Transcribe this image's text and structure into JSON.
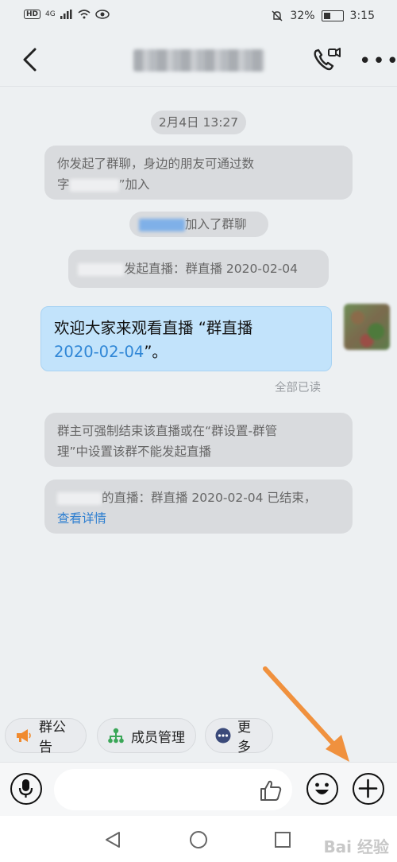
{
  "status_bar": {
    "hd": "HD",
    "signal": "4G",
    "battery": "32%",
    "time": "3:15"
  },
  "nav": {
    "title": "",
    "more_label": "•••"
  },
  "messages": {
    "timestamp": "2月4日 13:27",
    "sys1": {
      "part1": "你发起了群聊，身边的朋友可通过数",
      "part2": "字",
      "part3": "”加入"
    },
    "sys2": {
      "suffix": "加入了群聊"
    },
    "sys3": {
      "suffix": "发起直播：群直播 2020-02-04"
    },
    "mine": {
      "part1": "欢迎大家来观看直播 “群直播",
      "link": "2020-02-04",
      "part2": "”。"
    },
    "read_status": "全部已读",
    "sys4": {
      "line1": "群主可强制结束该直播或在“群设置-群管",
      "line2": "理”中设置该群不能发起直播"
    },
    "sys5": {
      "suffix": "的直播：群直播 2020-02-04 已结束，",
      "link": "查看详情"
    }
  },
  "quick_actions": [
    {
      "label": "群公告",
      "icon": "megaphone-icon"
    },
    {
      "label": "成员管理",
      "icon": "org-tree-icon"
    },
    {
      "label": "更多",
      "icon": "more-dots-icon"
    }
  ],
  "input_bar": {
    "placeholder": ""
  },
  "watermark": "Bai 经验",
  "colors": {
    "accent_blue": "#2f86d6",
    "own_bubble": "#c2e3fb",
    "system_bubble": "#d9dbde",
    "arrow": "#f0913e",
    "announcement_orange": "#f08a2e",
    "member_green": "#3aa657",
    "more_navy": "#3b4a7a"
  }
}
